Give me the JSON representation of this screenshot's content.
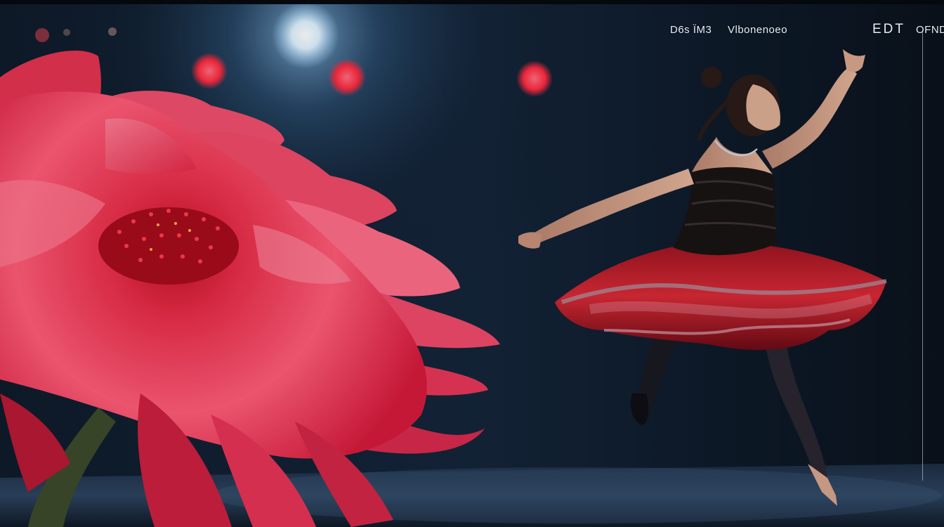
{
  "scene": {
    "description_icon": "photo-scene",
    "colors": {
      "background": "#0b1420",
      "stage_floor": "#2a3d55",
      "flower_main": "#e8304f",
      "flower_light": "#ff7a92",
      "dress_red": "#c41e2c",
      "bodice": "#1a1414",
      "spotlight": "#dff3ff",
      "stage_light_red": "#ff2a40"
    }
  },
  "overlay": {
    "text1": "D6s ÏM3",
    "text2": "Vlbonenoeo",
    "text3": "EDT",
    "text4": "OFND"
  }
}
